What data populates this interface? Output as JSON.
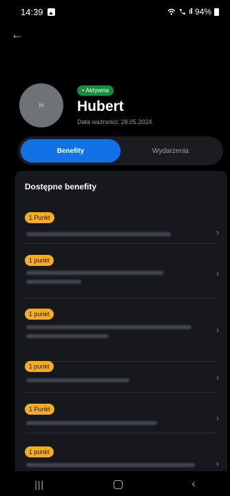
{
  "status_bar": {
    "time": "14:39",
    "signal": "ıll",
    "battery": "94%",
    "icons": [
      "image-icon",
      "wifi-icon",
      "call-icon",
      "signal-icon",
      "battery-icon"
    ]
  },
  "header": {
    "back_icon": "arrow-left-icon",
    "back_glyph": "←"
  },
  "profile": {
    "avatar_initial": "H",
    "status_badge": "• Aktywna",
    "name": "Hubert",
    "validity": "Data ważności: 28.05.2024"
  },
  "tabs": [
    {
      "label": "Benefity",
      "active": true
    },
    {
      "label": "Wydarzenia",
      "active": false
    }
  ],
  "benefits": {
    "title": "Dostępne benefity",
    "items": [
      {
        "points": "1 Punkt"
      },
      {
        "points": "1 punkt"
      },
      {
        "points": "1 punkt"
      },
      {
        "points": "1 punkt"
      },
      {
        "points": "1 Punkt"
      },
      {
        "points": "1 punkt"
      }
    ],
    "chevron": "›"
  },
  "nav": {
    "recent": "|||",
    "back": "‹"
  },
  "colors": {
    "accent": "#1172e6",
    "badge_green": "#1e8a3c",
    "chip_yellow": "#f5ad1e",
    "panel_bg": "#16181d"
  }
}
